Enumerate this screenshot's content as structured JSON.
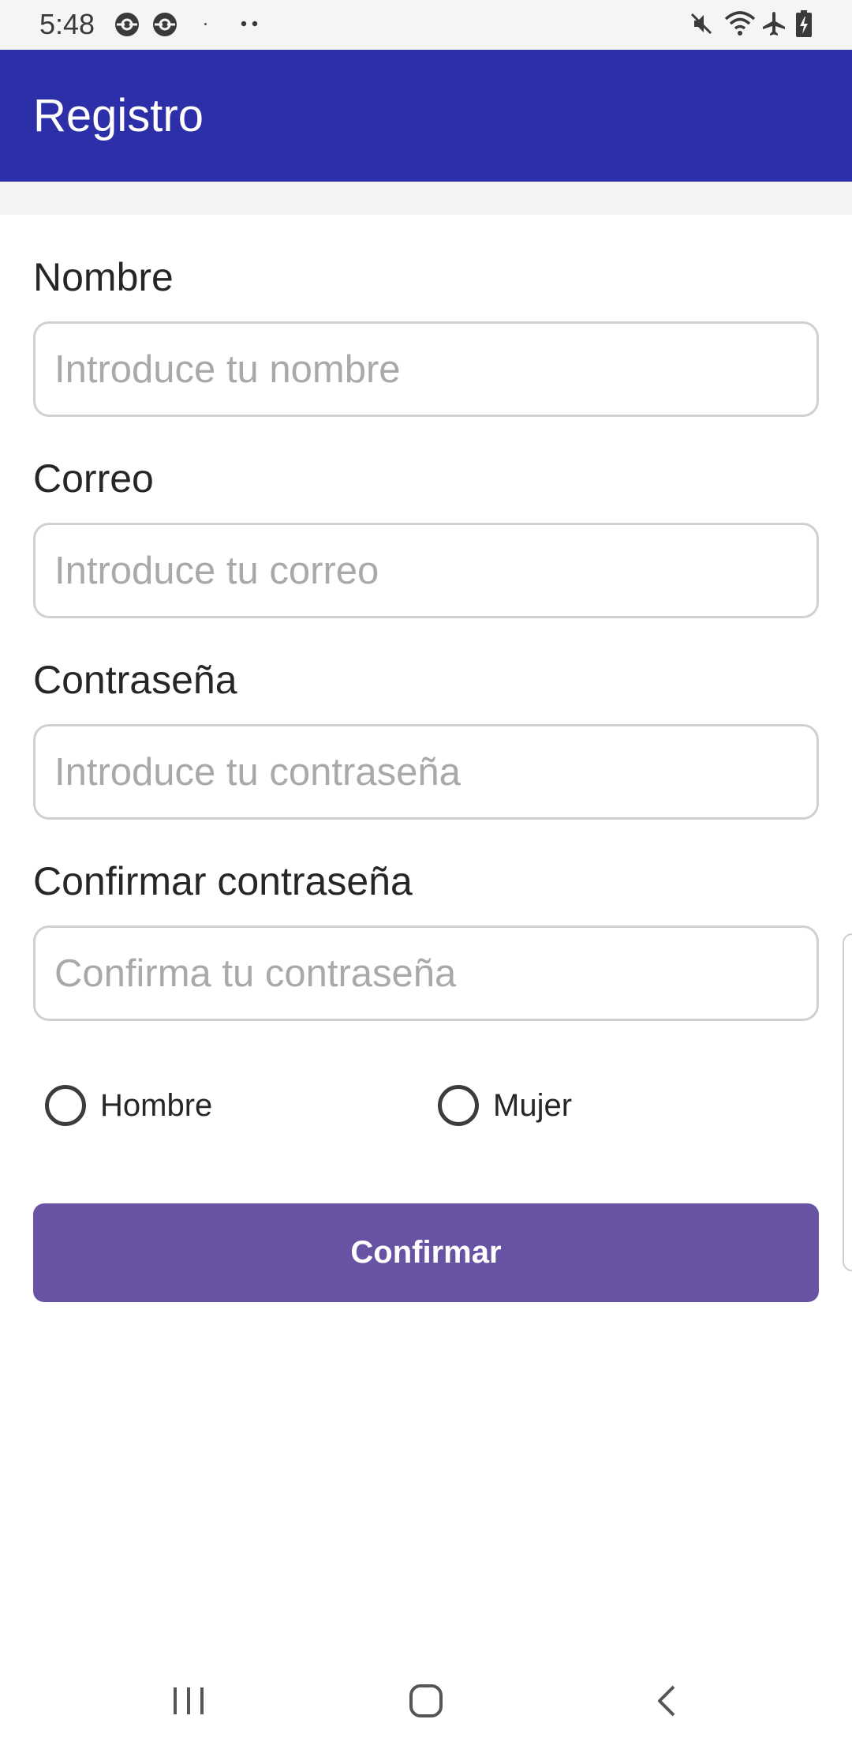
{
  "status_bar": {
    "time": "5:48",
    "icons": [
      "notification-icon",
      "notification-icon",
      "dots-icon",
      "mute-icon",
      "wifi-icon",
      "airplane-icon",
      "battery-charging-icon"
    ]
  },
  "app_bar": {
    "title": "Registro",
    "color": "#2c2fa7"
  },
  "form": {
    "name": {
      "label": "Nombre",
      "placeholder": "Introduce tu nombre",
      "value": ""
    },
    "email": {
      "label": "Correo",
      "placeholder": "Introduce tu correo",
      "value": ""
    },
    "password": {
      "label": "Contraseña",
      "placeholder": "Introduce tu contraseña",
      "value": ""
    },
    "confirm_password": {
      "label": "Confirmar contraseña",
      "placeholder": "Confirma tu contraseña",
      "value": ""
    },
    "gender_options": [
      {
        "label": "Hombre",
        "selected": false
      },
      {
        "label": "Mujer",
        "selected": false
      }
    ],
    "submit_label": "Confirmar",
    "submit_color": "#6852a4"
  },
  "nav_bar": {
    "buttons": [
      "recents-icon",
      "home-icon",
      "back-icon"
    ]
  }
}
